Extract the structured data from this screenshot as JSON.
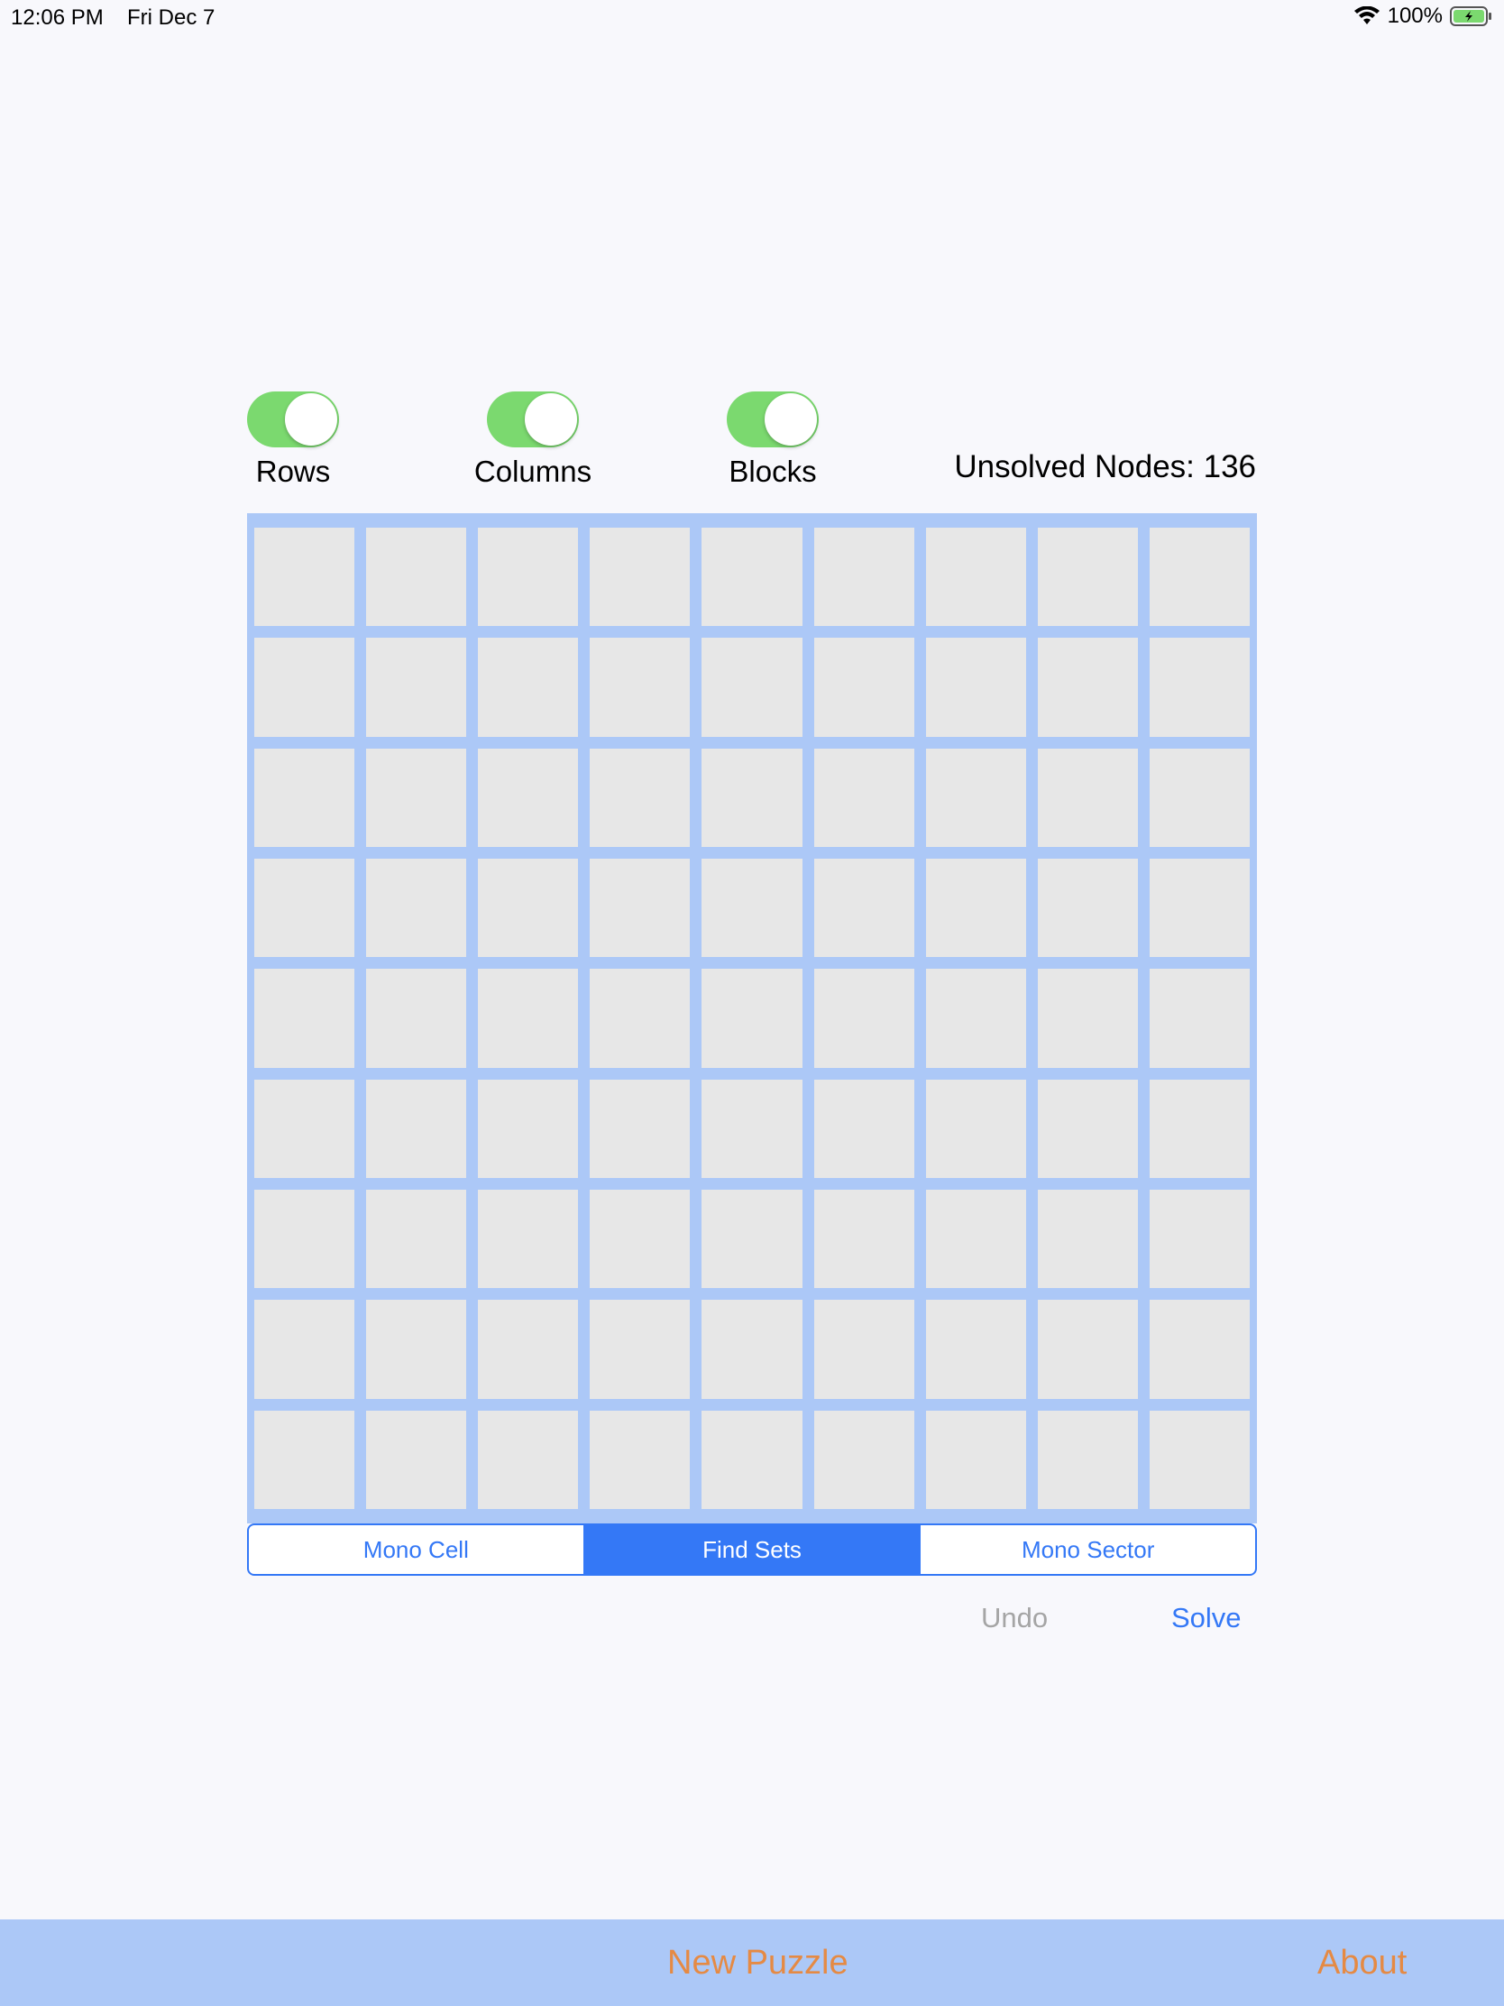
{
  "status": {
    "time": "12:06 PM",
    "date": "Fri Dec 7",
    "battery": "100%"
  },
  "toggles": [
    {
      "label": "Rows",
      "on": true
    },
    {
      "label": "Columns",
      "on": true
    },
    {
      "label": "Blocks",
      "on": true
    }
  ],
  "unsolved_nodes": "Unsolved Nodes: 136",
  "grid": {
    "rows": 9,
    "cols": 9
  },
  "segments": [
    {
      "label": "Mono Cell",
      "active": false
    },
    {
      "label": "Find Sets",
      "active": true
    },
    {
      "label": "Mono Sector",
      "active": false
    }
  ],
  "actions": {
    "undo": "Undo",
    "solve": "Solve"
  },
  "bottom_bar": {
    "new_puzzle": "New Puzzle",
    "about": "About"
  },
  "colors": {
    "accent": "#3478f6",
    "toggle_on": "#7bd96f",
    "grid_border": "#acc8f7",
    "cell": "#e7e7e7",
    "bottom_bar_text": "#e58a44"
  },
  "icons": [
    "wifi-icon",
    "battery-icon"
  ]
}
